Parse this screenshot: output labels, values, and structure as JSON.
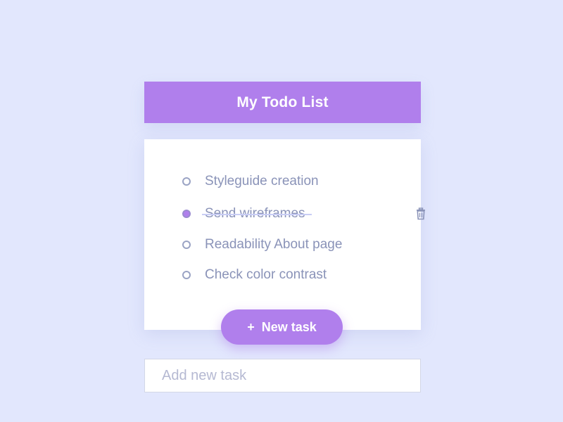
{
  "header": {
    "title": "My Todo List"
  },
  "tasks": [
    {
      "label": "Styleguide creation",
      "done": false
    },
    {
      "label": "Send wireframes",
      "done": true
    },
    {
      "label": "Readability About page",
      "done": false
    },
    {
      "label": "Check color contrast",
      "done": false
    }
  ],
  "actions": {
    "new_task_label": "New task",
    "new_task_icon": "plus-icon",
    "delete_icon": "trash-icon"
  },
  "add_task": {
    "value": "",
    "placeholder": "Add new task"
  },
  "colors": {
    "background": "#e2e7fd",
    "accent": "#b07fec",
    "text": "#8a93b8",
    "checkbox_border": "#9aa3c4"
  }
}
